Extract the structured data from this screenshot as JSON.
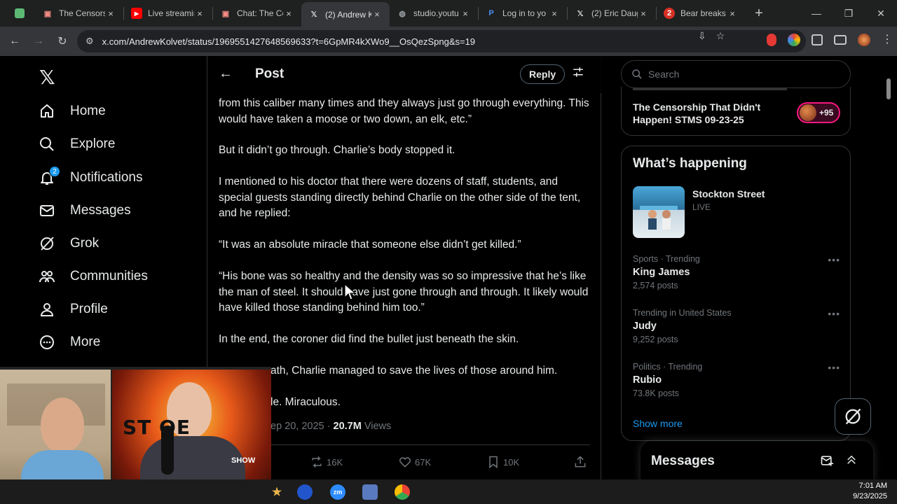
{
  "browser": {
    "tabs": [
      {
        "title": "The Censors",
        "close": "×"
      },
      {
        "title": "Live streamin",
        "close": "×"
      },
      {
        "title": "Chat: The Ce",
        "close": "×"
      },
      {
        "title": "(2) Andrew K",
        "close": "×"
      },
      {
        "title": "studio.youtu",
        "close": "×"
      },
      {
        "title": "Log in to yo",
        "close": "×"
      },
      {
        "title": "(2) Eric Daug",
        "close": "×"
      },
      {
        "title": "Bear breaks",
        "close": "×"
      }
    ],
    "new_tab": "+",
    "url": "x.com/AndrewKolvet/status/1969551427648569633?t=6GpMR4kXWo9__OsQezSpng&s=19"
  },
  "nav": {
    "items": [
      {
        "label": "Home",
        "icon": "home-icon"
      },
      {
        "label": "Explore",
        "icon": "search-icon"
      },
      {
        "label": "Notifications",
        "icon": "bell-icon",
        "badge": "2"
      },
      {
        "label": "Messages",
        "icon": "mail-icon"
      },
      {
        "label": "Grok",
        "icon": "grok-icon"
      },
      {
        "label": "Communities",
        "icon": "communities-icon"
      },
      {
        "label": "Profile",
        "icon": "profile-icon"
      },
      {
        "label": "More",
        "icon": "more-icon"
      }
    ]
  },
  "post": {
    "header_title": "Post",
    "reply_label": "Reply",
    "paragraphs": [
      "from this caliber many times and they always just go through everything. This would have taken a moose or two down, an elk, etc.”",
      "But it didn’t go through. Charlie’s body stopped it.",
      "I mentioned to his doctor that there were dozens of staff, students, and special guests standing directly behind Charlie on the other side of the tent, and he replied:",
      "“It was an absolute miracle that someone else didn’t get killed.”",
      "“His bone was so healthy and the density was so so impressive that he’s like the man of steel. It should have just gone through and through. It likely would have killed those standing behind him too.”",
      "In the end, the coroner did find the bullet just beneath the skin.",
      "ath, Charlie managed to save the lives of those around him.",
      "le. Miraculous."
    ],
    "date": "ep 20, 2025",
    "views_count": "20.7M",
    "views_label": "Views",
    "actions": {
      "reposts": "16K",
      "likes": "67K",
      "bookmarks": "10K"
    }
  },
  "sidebar": {
    "search_placeholder": "Search",
    "space_title": "The Censorship That Didn't Happen! STMS 09-23-25",
    "space_listeners": "+95",
    "happening_title": "What’s happening",
    "live": {
      "title": "Stockton Street",
      "sub": "LIVE"
    },
    "trends": [
      {
        "category": "Sports · Trending",
        "name": "King James",
        "count": "2,574 posts"
      },
      {
        "category": "Trending in United States",
        "name": "Judy",
        "count": "9,252 posts"
      },
      {
        "category": "Politics · Trending",
        "name": "Rubio",
        "count": "73.8K posts"
      }
    ],
    "show_more": "Show more",
    "messages_title": "Messages"
  },
  "overlay": {
    "cam_text": "ST    OE",
    "cam_text2": "SHOW"
  },
  "taskbar": {
    "time": "7:01 AM",
    "date": "9/23/2025"
  },
  "colors": {
    "accent": "#1d9bf0",
    "live_pink": "#f91880"
  }
}
